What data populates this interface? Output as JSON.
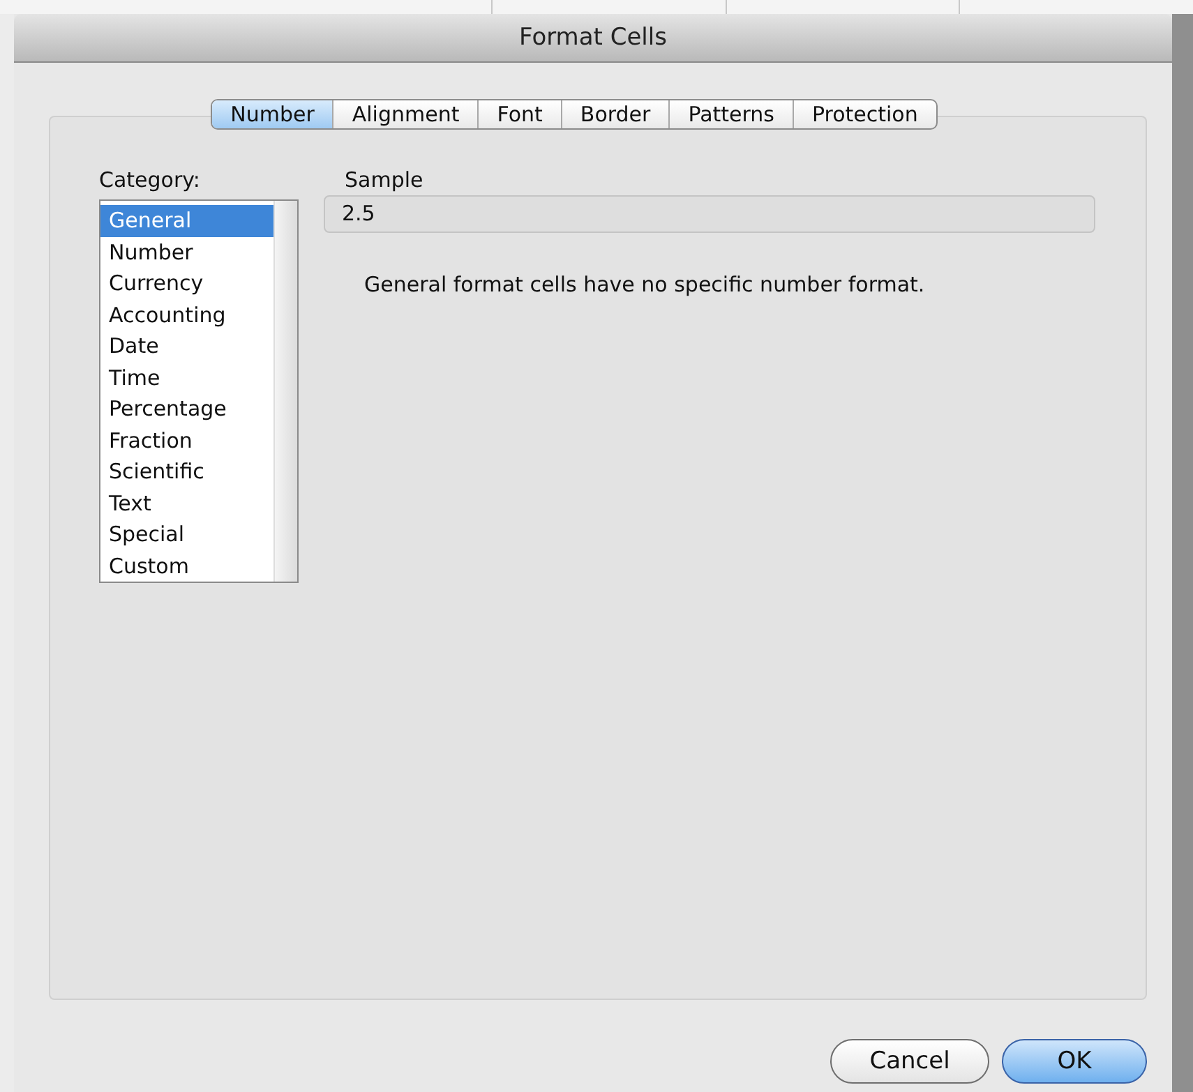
{
  "window": {
    "title": "Format Cells"
  },
  "tabs": [
    {
      "label": "Number",
      "selected": true
    },
    {
      "label": "Alignment",
      "selected": false
    },
    {
      "label": "Font",
      "selected": false
    },
    {
      "label": "Border",
      "selected": false
    },
    {
      "label": "Patterns",
      "selected": false
    },
    {
      "label": "Protection",
      "selected": false
    }
  ],
  "category": {
    "label": "Category:",
    "items": [
      {
        "label": "General",
        "selected": true
      },
      {
        "label": "Number",
        "selected": false
      },
      {
        "label": "Currency",
        "selected": false
      },
      {
        "label": "Accounting",
        "selected": false
      },
      {
        "label": "Date",
        "selected": false
      },
      {
        "label": "Time",
        "selected": false
      },
      {
        "label": "Percentage",
        "selected": false
      },
      {
        "label": "Fraction",
        "selected": false
      },
      {
        "label": "Scientific",
        "selected": false
      },
      {
        "label": "Text",
        "selected": false
      },
      {
        "label": "Special",
        "selected": false
      },
      {
        "label": "Custom",
        "selected": false
      }
    ]
  },
  "sample": {
    "label": "Sample",
    "value": "2.5"
  },
  "description": "General format cells have no specific number format.",
  "buttons": [
    {
      "label": "Cancel",
      "default": false
    },
    {
      "label": "OK",
      "default": true
    }
  ]
}
